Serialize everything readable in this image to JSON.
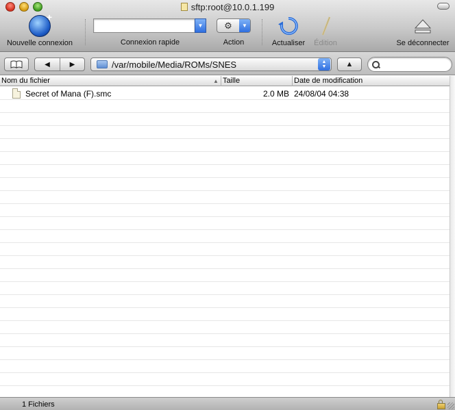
{
  "window": {
    "title": "sftp:root@10.0.1.199"
  },
  "toolbar": {
    "new_connection_label": "Nouvelle connexion",
    "quick_connect_label": "Connexion rapide",
    "quick_connect_value": "",
    "action_label": "Action",
    "refresh_label": "Actualiser",
    "edit_label": "Édition",
    "disconnect_label": "Se déconnecter"
  },
  "navbar": {
    "bookmarks_glyph": "📖",
    "back_glyph": "◀",
    "forward_glyph": "▶",
    "path": "/var/mobile/Media/ROMs/SNES",
    "up_glyph": "▲",
    "search_value": ""
  },
  "columns": {
    "name": "Nom du fichier",
    "size": "Taille",
    "date": "Date de modification"
  },
  "files": [
    {
      "name": "Secret of Mana (F).smc",
      "size": "2.0 MB",
      "date": "24/08/04 04:38"
    }
  ],
  "status": {
    "text": "1 Fichiers"
  },
  "icons": {
    "new_connection": "globe-plus-icon",
    "action": "gear-icon",
    "refresh": "refresh-icon",
    "edit": "pencil-icon",
    "disconnect": "eject-icon",
    "bookmarks": "book-icon",
    "folder": "folder-icon",
    "search": "search-icon",
    "file": "document-icon",
    "lock": "lock-icon"
  },
  "colors": {
    "accent_blue": "#2f6fe0",
    "close": "#d4301f",
    "minimize": "#d59a10",
    "zoom": "#3d9a1e"
  }
}
